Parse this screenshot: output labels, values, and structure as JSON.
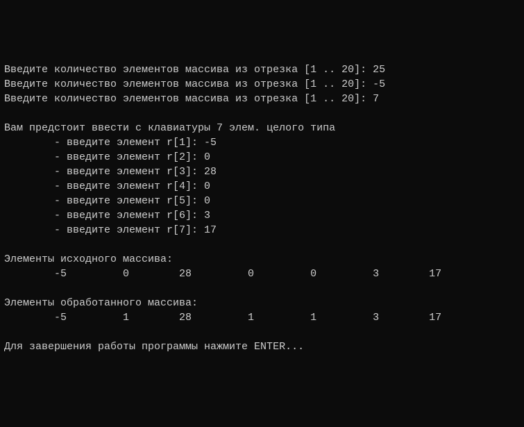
{
  "prompts": [
    {
      "text": "Введите количество элементов массива из отрезка [1 .. 20]: ",
      "input": "25"
    },
    {
      "text": "Введите количество элементов массива из отрезка [1 .. 20]: ",
      "input": "-5"
    },
    {
      "text": "Введите количество элементов массива из отрезка [1 .. 20]: ",
      "input": "7"
    }
  ],
  "count": 7,
  "header_before": "Вам предстоит ввести с клавиатуры ",
  "header_after": " элем. целого типа",
  "element_prompt_prefix": "        - введите элемент r[",
  "element_prompt_suffix": "]: ",
  "elements": [
    {
      "index": 1,
      "value": "-5"
    },
    {
      "index": 2,
      "value": "0"
    },
    {
      "index": 3,
      "value": "28"
    },
    {
      "index": 4,
      "value": "0"
    },
    {
      "index": 5,
      "value": "0"
    },
    {
      "index": 6,
      "value": "3"
    },
    {
      "index": 7,
      "value": "17"
    }
  ],
  "source_label": "Элементы исходного массива:",
  "source_array": [
    "-5",
    "0",
    "28",
    "0",
    "0",
    "3",
    "17"
  ],
  "processed_label": "Элементы обработанного массива:",
  "processed_array": [
    "-5",
    "1",
    "28",
    "1",
    "1",
    "3",
    "17"
  ],
  "exit_prompt": "Для завершения работы программы нажмите ENTER..."
}
